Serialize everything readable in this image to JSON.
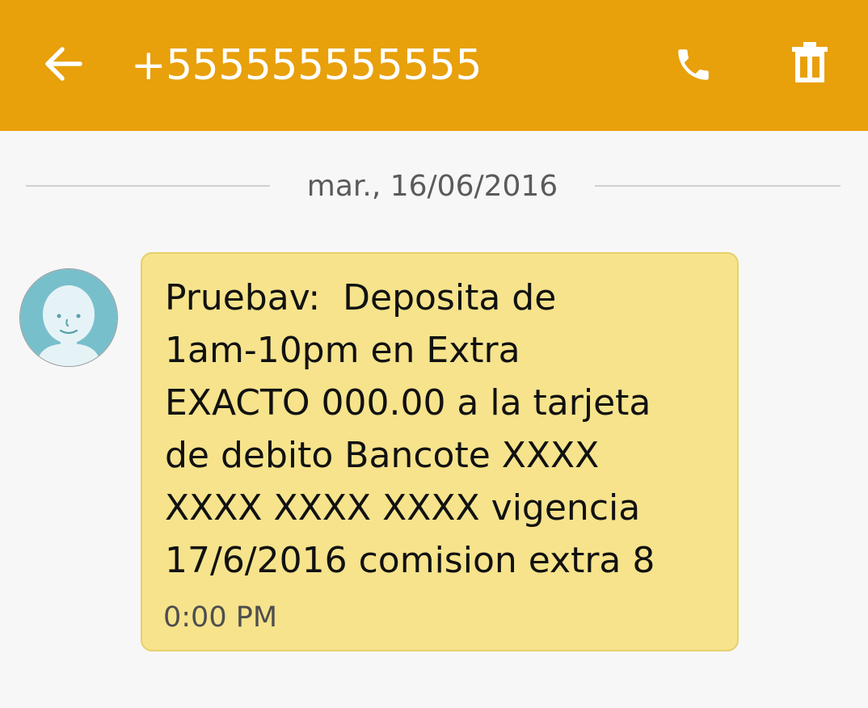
{
  "colors": {
    "appbar": "#e8a00b",
    "bubble": "#f6e38c",
    "background": "#f7f7f7",
    "avatar_bg": "#78bfcc"
  },
  "header": {
    "back_icon": "arrow-left-icon",
    "title": "+555555555555",
    "call_icon": "phone-icon",
    "delete_icon": "trash-icon"
  },
  "conversation": {
    "date_label": "mar., 16/06/2016",
    "message": {
      "sender_avatar_icon": "contact-avatar-icon",
      "text": "Pruebav:  Deposita de\n1am-10pm en Extra\nEXACTO 000.00 a la tarjeta\nde debito Bancote XXXX\nXXXX XXXX XXXX vigencia\n17/6/2016 comision extra 8",
      "time": "0:00 PM"
    }
  }
}
